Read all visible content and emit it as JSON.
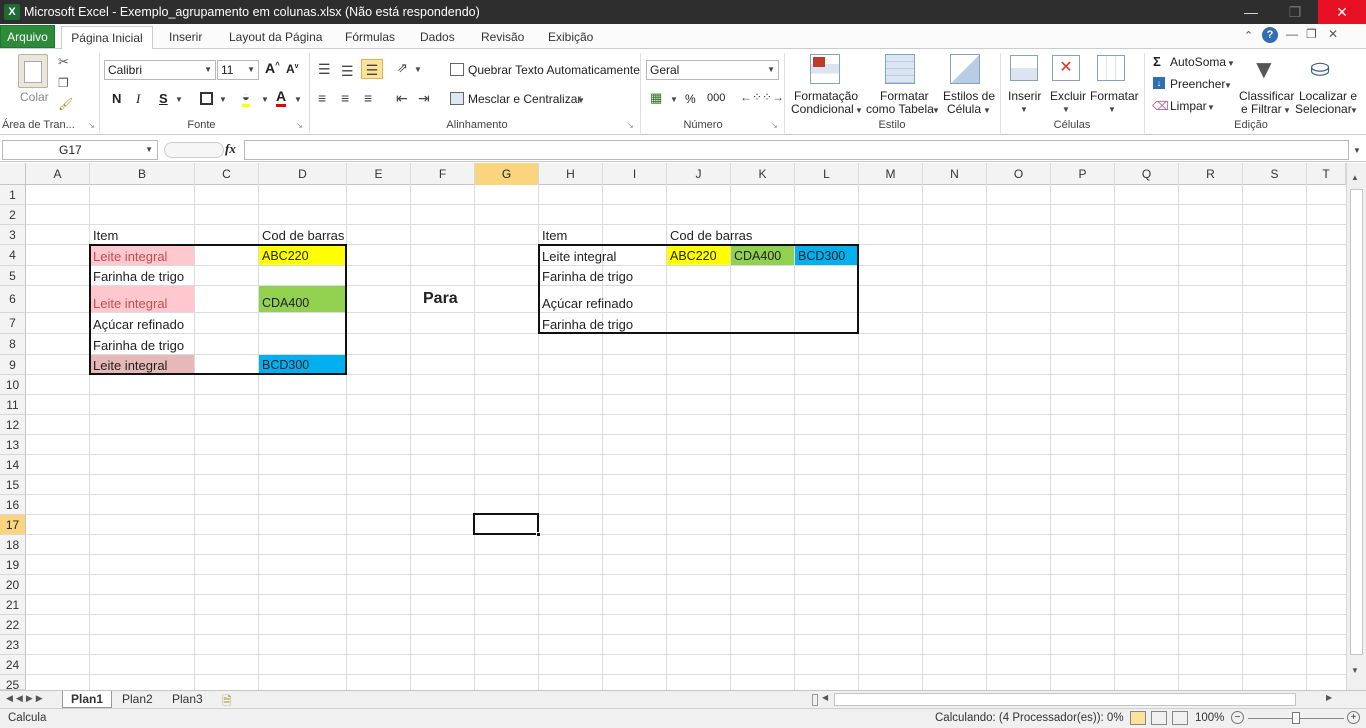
{
  "window": {
    "title": "Microsoft Excel - Exemplo_agrupamento em colunas.xlsx (Não está respondendo)",
    "app_icon": "X"
  },
  "tabs": [
    {
      "label": "Arquivo"
    },
    {
      "label": "Página Inicial"
    },
    {
      "label": "Inserir"
    },
    {
      "label": "Layout da Página"
    },
    {
      "label": "Fórmulas"
    },
    {
      "label": "Dados"
    },
    {
      "label": "Revisão"
    },
    {
      "label": "Exibição"
    }
  ],
  "ribbon": {
    "clipboard": {
      "paste": "Colar",
      "label": "Área de Tran..."
    },
    "font": {
      "name": "Calibri",
      "size": "11",
      "bold": "N",
      "italic": "I",
      "underline": "S",
      "label": "Fonte"
    },
    "alignment": {
      "wrap": "Quebrar Texto Automaticamente",
      "merge": "Mesclar e Centralizar",
      "label": "Alinhamento"
    },
    "number": {
      "format": "Geral",
      "percent": "%",
      "thousands": "000",
      "label": "Número"
    },
    "styles": {
      "conditional_1": "Formatação",
      "conditional_2": "Condicional",
      "table_1": "Formatar",
      "table_2": "como Tabela",
      "cell_1": "Estilos de",
      "cell_2": "Célula",
      "label": "Estilo"
    },
    "cells": {
      "insert": "Inserir",
      "delete": "Excluir",
      "format": "Formatar",
      "label": "Células"
    },
    "editing": {
      "autosum": "AutoSoma",
      "fill": "Preencher",
      "clear": "Limpar",
      "sort_1": "Classificar",
      "sort_2": "e Filtrar",
      "find_1": "Localizar e",
      "find_2": "Selecionar",
      "label": "Edição"
    }
  },
  "formula_bar": {
    "name_box": "G17",
    "fx": "fx",
    "value": ""
  },
  "columns": [
    "A",
    "B",
    "C",
    "D",
    "E",
    "F",
    "G",
    "H",
    "I",
    "J",
    "K",
    "L",
    "M",
    "N",
    "O",
    "P",
    "Q",
    "R",
    "S",
    "T"
  ],
  "rows": [
    "1",
    "2",
    "3",
    "4",
    "5",
    "6",
    "7",
    "8",
    "9",
    "10",
    "11",
    "12",
    "13",
    "14",
    "15",
    "16",
    "17",
    "18",
    "19",
    "20",
    "21",
    "22",
    "23",
    "24",
    "25"
  ],
  "selected": {
    "column": "G",
    "row": "17"
  },
  "cells": {
    "B3": "Item",
    "D3": "Cod de barras",
    "B4": "Leite integral",
    "D4": "ABC220",
    "B5": "Farinha de trigo",
    "B6": "Leite integral",
    "D6": "CDA400",
    "B7": "Açúcar refinado",
    "B8": "Farinha de trigo",
    "B9": "Leite integral",
    "D9": "BCD300",
    "F6": "Para",
    "H3": "Item",
    "J3": "Cod de barras",
    "H4": "Leite integral",
    "J4": "ABC220",
    "K4": "CDA400",
    "L4": "BCD300",
    "H5": "Farinha de trigo",
    "H6": "Açúcar refinado",
    "H7": "Farinha de trigo"
  },
  "colors": {
    "pink": "#ffc7ce",
    "pink_dark": "#e6b8b7",
    "pink_text": "#c0504d",
    "yellow": "#ffff00",
    "green": "#92d050",
    "blue": "#00b0f0",
    "arquivo": "#2e8b3b"
  },
  "sheets": [
    {
      "label": "Plan1",
      "active": true
    },
    {
      "label": "Plan2"
    },
    {
      "label": "Plan3"
    }
  ],
  "status": {
    "mode": "Calcula",
    "calc": "Calculando: (4 Processador(es)): 0%",
    "zoom": "100%"
  }
}
